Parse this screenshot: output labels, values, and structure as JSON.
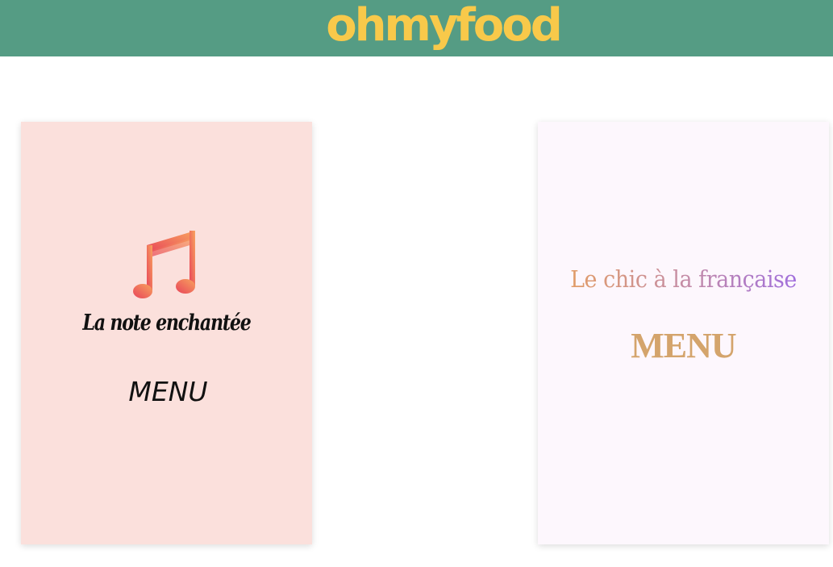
{
  "header": {
    "logo": "ohmyfood",
    "background_color": "#559c84",
    "logo_color": "#f8c94a"
  },
  "cards": [
    {
      "icon": "music-note-icon",
      "title": "La note enchantée",
      "menu_label": "MENU",
      "background_color": "#fbe0dc"
    },
    {
      "title": "Le chic à la française",
      "menu_label": "MENU",
      "background_color": "#fdf7fd",
      "title_gradient": [
        "#e7a05c",
        "#9a6ae8"
      ],
      "menu_color": "#d4a46c"
    }
  ]
}
